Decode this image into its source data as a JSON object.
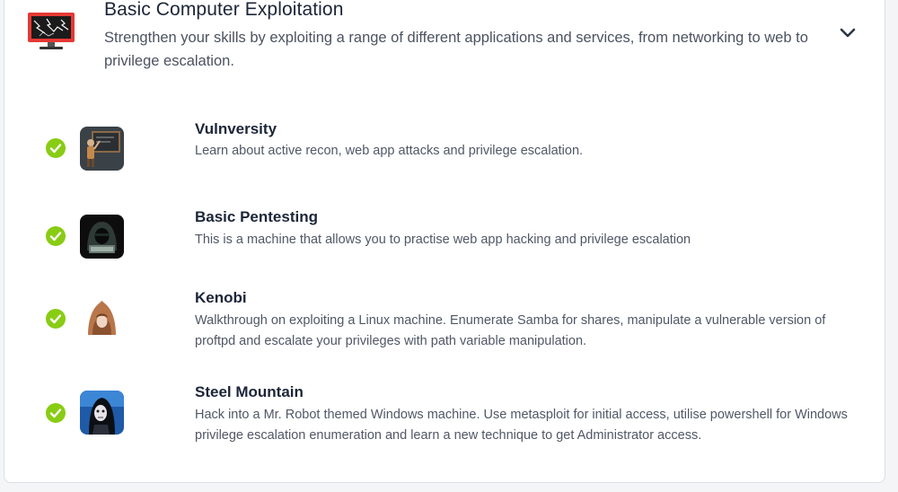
{
  "module": {
    "title": "Basic Computer Exploitation",
    "description": "Strengthen your skills by exploiting a range of different applications and services, from networking to web to privilege escalation.",
    "icon": "monitor-lightning-icon",
    "toggle_icon": "chevron-down-icon"
  },
  "rooms": [
    {
      "title": "Vulnversity",
      "description": "Learn about active recon, web app attacks and privilege escalation.",
      "completed": true,
      "icon": "vulnversity-room-icon"
    },
    {
      "title": "Basic Pentesting",
      "description": "This is a machine that allows you to practise web app hacking and privilege escalation",
      "completed": true,
      "icon": "hooded-hacker-room-icon"
    },
    {
      "title": "Kenobi",
      "description": "Walkthrough on exploiting a Linux machine. Enumerate Samba for shares, manipulate a vulnerable version of proftpd and escalate your privileges with path variable manipulation.",
      "completed": true,
      "icon": "hooded-figure-room-icon"
    },
    {
      "title": "Steel Mountain",
      "description": "Hack into a Mr. Robot themed Windows machine. Use metasploit for initial access, utilise powershell for Windows privilege escalation enumeration and learn a new technique to get Administrator access.",
      "completed": true,
      "icon": "mr-robot-room-icon"
    }
  ],
  "colors": {
    "check_green": "#88cc14",
    "title": "#1c2538",
    "text": "#505766"
  }
}
